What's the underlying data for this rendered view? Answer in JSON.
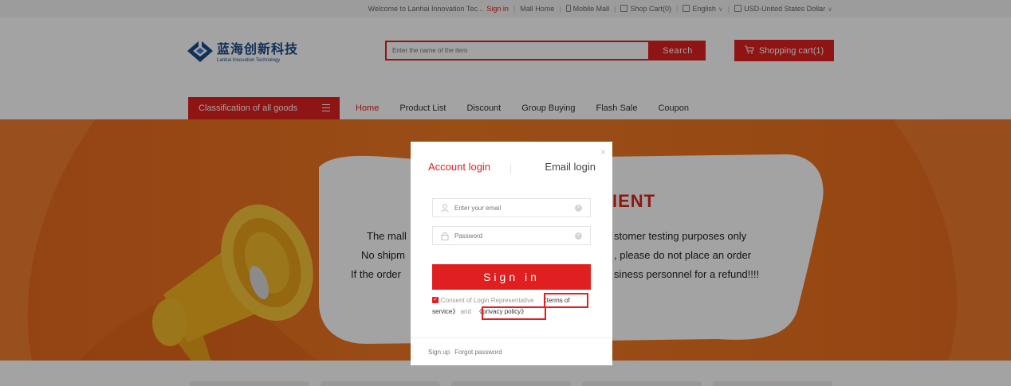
{
  "topbar": {
    "welcome": "Welcome to Lanhai Innovation Tec...",
    "sign_in": "Sign in",
    "mall_home": "Mall Home",
    "mobile_mall": "Mobile Mall",
    "shop_cart": "Shop Cart(0)",
    "language": "English",
    "currency": "USD-United States Dollar"
  },
  "header": {
    "logo_cn": "蓝海创新科技",
    "logo_en": "Lanhai Innovation Technology",
    "search_placeholder": "Enter the name of the item",
    "search_button": "Search",
    "cart_button": "Shopping cart(1)"
  },
  "nav": {
    "category_button": "Classification of all goods",
    "links": [
      "Home",
      "Product List",
      "Discount",
      "Group Buying",
      "Flash Sale",
      "Coupon"
    ],
    "active_index": 0
  },
  "banner": {
    "title_fragment": "IENT",
    "line1_left": "The mall",
    "line1_right": "stomer testing purposes only",
    "line2_left": "No shipm",
    "line2_right": ", please do not place an order",
    "line3_left": "If the order",
    "line3_right": "siness personnel for a refund!!!!"
  },
  "login_modal": {
    "close_symbol": "×",
    "tab_account": "Account login",
    "tab_email": "Email login",
    "active_tab": "account",
    "email_placeholder": "Enter your email",
    "password_placeholder": "Password",
    "sign_in_button": "Sign in",
    "consent_text": "Consent of Login Representative",
    "terms_link": "《terms of service》",
    "and_text": "and",
    "privacy_link": "《privacy policy》",
    "consent_checked": true,
    "sign_up": "Sign up",
    "forgot_password": "Forgot password"
  },
  "colors": {
    "accent": "#e02020",
    "brand_blue": "#1a4c8a",
    "banner_orange": "#ee7520",
    "overlay": "rgba(0,0,0,0.36)"
  }
}
